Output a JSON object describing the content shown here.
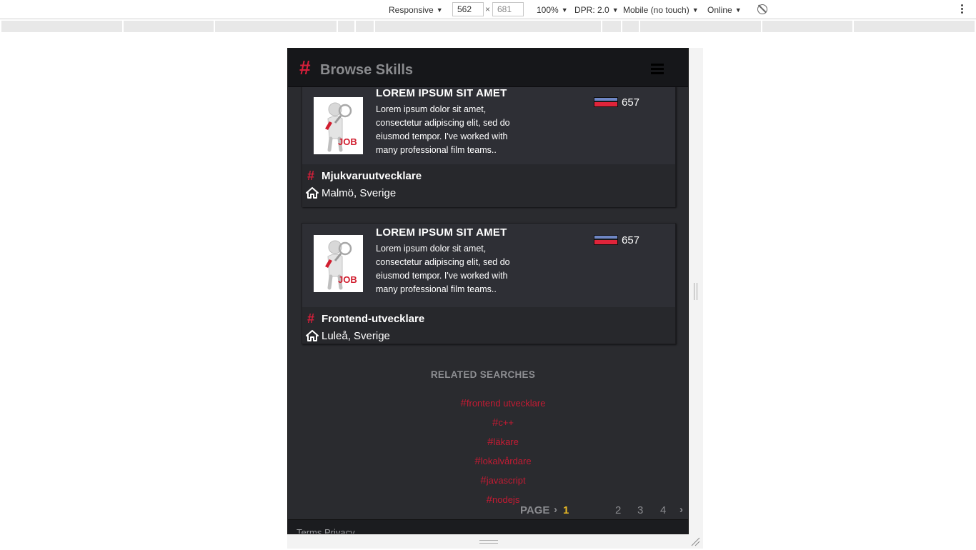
{
  "devtools": {
    "device_mode": "Responsive",
    "width": "562",
    "height": "681",
    "zoom": "100%",
    "dpr": "DPR: 2.0",
    "device_type": "Mobile (no touch)",
    "network": "Online",
    "separator": "×"
  },
  "app": {
    "brand_hash": "#",
    "title": "Browse Skills"
  },
  "cards": [
    {
      "title": "LOREM IPSUM SIT AMET",
      "description": "Lorem ipsum dolor sit amet, consectetur adipiscing elit, sed do eiusmod tempor. I've worked with many professional film teams..",
      "count": "657",
      "skill_hash": "#",
      "skill": "Mjukvaruutvecklare",
      "location": "Malmö, Sverige",
      "thumb_text": "JOB"
    },
    {
      "title": "LOREM IPSUM SIT AMET",
      "description": "Lorem ipsum dolor sit amet, consectetur adipiscing elit, sed do eiusmod tempor. I've worked with many professional film teams..",
      "count": "657",
      "skill_hash": "#",
      "skill": "Frontend-utvecklare",
      "location": "Luleå, Sverige",
      "thumb_text": "JOB"
    }
  ],
  "related": {
    "title": "RELATED SEARCHES",
    "items": [
      {
        "hash": "#",
        "label": "frontend utvecklare"
      },
      {
        "hash": "#",
        "label": "c++"
      },
      {
        "hash": "#",
        "label": "läkare"
      },
      {
        "hash": "#",
        "label": "lokalvårdare"
      },
      {
        "hash": "#",
        "label": "javascript"
      },
      {
        "hash": "#",
        "label": "nodejs"
      }
    ]
  },
  "pagination": {
    "label": "PAGE",
    "prev_chevron": "›",
    "current": "1",
    "pages": [
      "2",
      "3",
      "4"
    ],
    "next_chevron": "›"
  },
  "footer": {
    "links": "Terms Privacy"
  },
  "colors": {
    "accent": "#d51f3a",
    "page_active": "#e8b825",
    "background": "#2a2b2f",
    "header": "#16171a"
  }
}
